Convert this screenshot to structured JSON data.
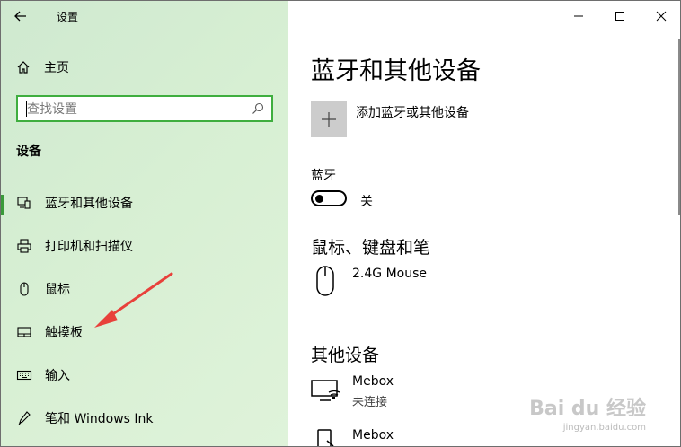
{
  "app": {
    "title": "设置"
  },
  "sidebar": {
    "home_label": "主页",
    "search_placeholder": "查找设置",
    "section_title": "设备",
    "items": [
      {
        "label": "蓝牙和其他设备",
        "icon": "bluetooth-devices-icon",
        "selected": true
      },
      {
        "label": "打印机和扫描仪",
        "icon": "printer-icon",
        "selected": false
      },
      {
        "label": "鼠标",
        "icon": "mouse-icon",
        "selected": false
      },
      {
        "label": "触摸板",
        "icon": "touchpad-icon",
        "selected": false
      },
      {
        "label": "输入",
        "icon": "keyboard-icon",
        "selected": false
      },
      {
        "label": "笔和 Windows Ink",
        "icon": "pen-icon",
        "selected": false
      }
    ]
  },
  "main": {
    "page_title": "蓝牙和其他设备",
    "add_device_label": "添加蓝牙或其他设备",
    "bluetooth_label": "蓝牙",
    "bluetooth_state": "关",
    "mouse_section_title": "鼠标、键盘和笔",
    "mouse_devices": [
      {
        "name": "2.4G Mouse",
        "icon": "mouse-device-icon"
      }
    ],
    "other_section_title": "其他设备",
    "other_devices": [
      {
        "name": "Mebox",
        "status": "未连接",
        "icon": "display-wireless-icon"
      },
      {
        "name": "Mebox",
        "status": "",
        "icon": "phone-device-icon"
      }
    ]
  },
  "watermark": {
    "text": "Bai du 经验",
    "sub": "jingyan.baidu.com"
  },
  "colors": {
    "accent": "#3a9a3a",
    "sidebar_bg": "#d7efd3",
    "annotation_arrow": "#e8413b"
  }
}
